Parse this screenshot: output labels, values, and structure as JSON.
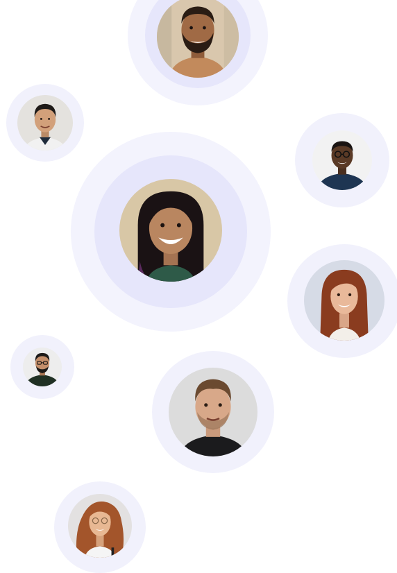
{
  "people": [
    {
      "id": "p1",
      "description_icon": "man-beard-photo",
      "colors": {
        "bg": "#d9c7ad",
        "skin": "#a06a45",
        "hair": "#2a1c14",
        "shirt": "#c28a5c"
      }
    },
    {
      "id": "p2",
      "description_icon": "man-short-hair-photo",
      "colors": {
        "bg": "#e4e2de",
        "skin": "#d2a07a",
        "hair": "#1e1a18",
        "shirt": "#f1f1f1"
      }
    },
    {
      "id": "p3",
      "description_icon": "man-glasses-photo",
      "colors": {
        "bg": "#f2f2f2",
        "skin": "#5a3a26",
        "hair": "#1a1412",
        "shirt": "#1e3552"
      }
    },
    {
      "id": "p4",
      "description_icon": "woman-smiling-photo",
      "colors": {
        "bg": "#d8c7a6",
        "skin": "#b98660",
        "hair": "#1a1214",
        "shirt": "#2e5a48"
      }
    },
    {
      "id": "p5",
      "description_icon": "woman-red-hair-photo",
      "colors": {
        "bg": "#d6dbe6",
        "skin": "#e9b99a",
        "hair": "#8a3c1f",
        "shirt": "#f3efe9"
      }
    },
    {
      "id": "p6",
      "description_icon": "man-glasses-dark-photo",
      "colors": {
        "bg": "#ededed",
        "skin": "#c48f6b",
        "hair": "#1c1a18",
        "shirt": "#203024"
      }
    },
    {
      "id": "p7",
      "description_icon": "man-stubble-photo",
      "colors": {
        "bg": "#dcdcdc",
        "skin": "#d8a889",
        "hair": "#6b4a30",
        "shirt": "#1b1b1d"
      }
    },
    {
      "id": "p8",
      "description_icon": "woman-curly-hair-photo",
      "colors": {
        "bg": "#e3e1e1",
        "skin": "#e8b893",
        "hair": "#a3552b",
        "shirt": "#f5f5f5"
      }
    }
  ],
  "ring_colors": {
    "outer": "#f3f3fd",
    "inner": "#e6e6fb"
  }
}
